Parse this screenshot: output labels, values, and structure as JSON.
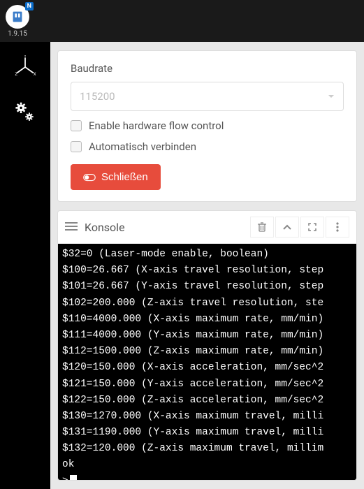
{
  "app": {
    "badge": "N",
    "version": "1.9.15"
  },
  "connection": {
    "baudrate_label": "Baudrate",
    "baudrate_value": "115200",
    "flow_control_label": "Enable hardware flow control",
    "auto_connect_label": "Automatisch verbinden",
    "close_label": "Schließen"
  },
  "console": {
    "title": "Konsole",
    "prompt": ">",
    "lines": [
      "$32=0 (Laser-mode enable, boolean)",
      "$100=26.667 (X-axis travel resolution, step",
      "$101=26.667 (Y-axis travel resolution, step",
      "$102=200.000 (Z-axis travel resolution, ste",
      "$110=4000.000 (X-axis maximum rate, mm/min)",
      "$111=4000.000 (Y-axis maximum rate, mm/min)",
      "$112=1500.000 (Z-axis maximum rate, mm/min)",
      "$120=150.000 (X-axis acceleration, mm/sec^2",
      "$121=150.000 (Y-axis acceleration, mm/sec^2",
      "$122=150.000 (Z-axis acceleration, mm/sec^2",
      "$130=1270.000 (X-axis maximum travel, milli",
      "$131=1190.000 (Y-axis maximum travel, milli",
      "$132=120.000 (Z-axis maximum travel, millim",
      "ok"
    ]
  }
}
